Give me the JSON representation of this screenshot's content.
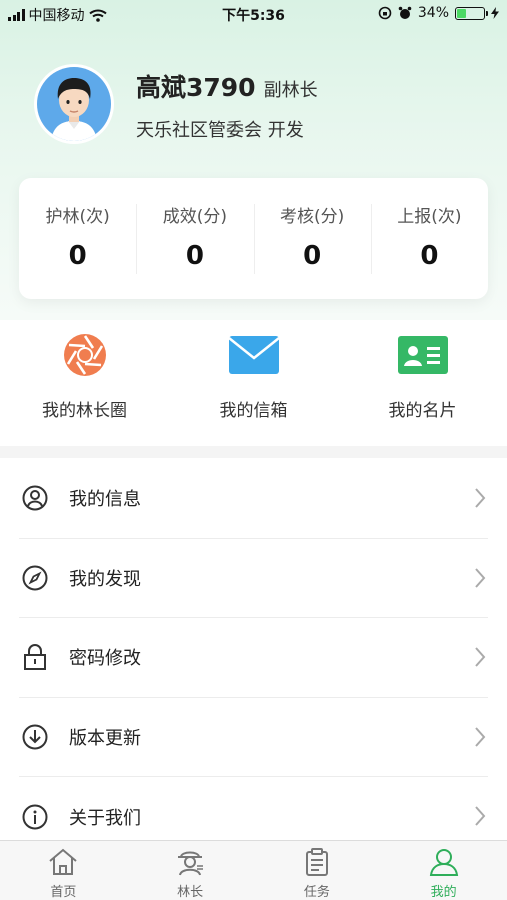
{
  "status_bar": {
    "carrier": "中国移动",
    "time": "下午5:36",
    "battery_percent": "34%",
    "battery_level": 0.34
  },
  "profile": {
    "name": "高斌3790",
    "role": "副林长",
    "organization": "天乐社区管委会 开发"
  },
  "stats": [
    {
      "label": "护林(次)",
      "value": "0"
    },
    {
      "label": "成效(分)",
      "value": "0"
    },
    {
      "label": "考核(分)",
      "value": "0"
    },
    {
      "label": "上报(次)",
      "value": "0"
    }
  ],
  "shortcuts": [
    {
      "label": "我的林长圈",
      "icon": "aperture-icon"
    },
    {
      "label": "我的信箱",
      "icon": "mail-icon"
    },
    {
      "label": "我的名片",
      "icon": "id-card-icon"
    }
  ],
  "menu": [
    {
      "label": "我的信息",
      "icon": "user-circle-icon"
    },
    {
      "label": "我的发现",
      "icon": "compass-icon"
    },
    {
      "label": "密码修改",
      "icon": "lock-icon"
    },
    {
      "label": "版本更新",
      "icon": "download-circle-icon"
    },
    {
      "label": "关于我们",
      "icon": "info-icon"
    }
  ],
  "tabs": [
    {
      "label": "首页",
      "icon": "home-icon"
    },
    {
      "label": "林长",
      "icon": "ranger-icon"
    },
    {
      "label": "任务",
      "icon": "clipboard-icon"
    },
    {
      "label": "我的",
      "icon": "person-icon",
      "active": true
    }
  ],
  "colors": {
    "accent_green": "#2fae5a",
    "mail_blue": "#3aa7ea",
    "aperture_orange": "#f07d4f",
    "card_green": "#35b866"
  }
}
